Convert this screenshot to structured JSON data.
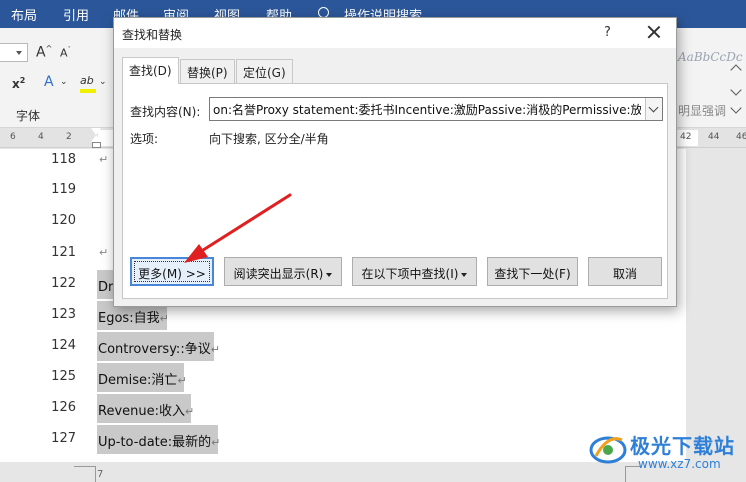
{
  "ribbon": {
    "tabs": [
      "布局",
      "引用",
      "邮件",
      "审阅",
      "视图",
      "帮助"
    ],
    "tell_me": "操作说明搜索",
    "font_group_label": "字体",
    "style_preview": "AaBbCcDc",
    "style_label": "明显强调"
  },
  "ruler": {
    "numbers": [
      "6",
      "4",
      "2",
      "42",
      "44",
      "46"
    ]
  },
  "document": {
    "lines": [
      {
        "num": "118",
        "text": "",
        "selected": false
      },
      {
        "num": "119",
        "text": "",
        "selected": false
      },
      {
        "num": "120",
        "text": "",
        "selected": false
      },
      {
        "num": "121",
        "text": "",
        "selected": false
      },
      {
        "num": "122",
        "text": "Drama:戏剧",
        "selected": true
      },
      {
        "num": "123",
        "text": "Egos:自我",
        "selected": true
      },
      {
        "num": "124",
        "text": "Controversy::争议",
        "selected": true
      },
      {
        "num": "125",
        "text": "Demise:消亡",
        "selected": true
      },
      {
        "num": "126",
        "text": "Revenue:收入",
        "selected": true
      },
      {
        "num": "127",
        "text": "Up-to-date:最新的",
        "selected": true
      }
    ],
    "page2_number": "7"
  },
  "dialog": {
    "title": "查找和替换",
    "help": "?",
    "tabs": [
      "查找(D)",
      "替换(P)",
      "定位(G)"
    ],
    "find_label": "查找内容(N):",
    "find_value": "on:名誉Proxy statement:委托书Incentive:激励Passive:消极的Permissive:放纵的",
    "options_label": "选项:",
    "options_value": "向下搜索, 区分全/半角",
    "buttons": {
      "more": "更多(M) >>",
      "reading_highlight": "阅读突出显示(R)",
      "find_in": "在以下项中查找(I)",
      "find_next": "查找下一处(F)",
      "cancel": "取消"
    }
  },
  "colors": {
    "ribbon_blue": "#2b579a",
    "selection_gray": "#c9c9c9",
    "arrow_red": "#e02020",
    "focus_blue": "#4a86d8"
  },
  "watermark": {
    "name": "极光下载站",
    "url": "www.xz7.com"
  }
}
